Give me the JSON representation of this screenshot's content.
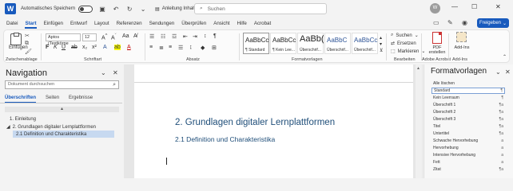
{
  "titlebar": {
    "autosave_label": "Automatisches Speichern",
    "document_title": "Anleitung Inhaltsverzeic...",
    "search_placeholder": "Suchen",
    "user_initials": "W"
  },
  "ribbon_tabs": [
    "Datei",
    "Start",
    "Einfügen",
    "Entwurf",
    "Layout",
    "Referenzen",
    "Sendungen",
    "Überprüfen",
    "Ansicht",
    "Hilfe",
    "Acrobat"
  ],
  "active_tab": "Start",
  "share_button": "Freigeben",
  "clipboard": {
    "paste_label": "Einfügen",
    "group_label": "Zwischenablage"
  },
  "font": {
    "family": "Aptos (Textkörpe",
    "size": "12",
    "group_label": "Schriftart"
  },
  "paragraph": {
    "group_label": "Absatz"
  },
  "styles": {
    "group_label": "Formatvorlagen",
    "cards": [
      {
        "sample": "AaBbCcI",
        "name": "¶ Standard"
      },
      {
        "sample": "AaBbCcI",
        "name": "¶ Kein Lee..."
      },
      {
        "sample": "AaBb(",
        "name": "Überschrif..."
      },
      {
        "sample": "AaBbC",
        "name": "Überschrif..."
      },
      {
        "sample": "AaBbCc",
        "name": "Überschrif..."
      }
    ]
  },
  "editing": {
    "group_label": "Bearbeiten",
    "search": "Suchen",
    "replace": "Ersetzen",
    "select": "Markieren"
  },
  "acrobat": {
    "pdf_label": "PDF erstellen",
    "group_label": "Adobe Acrobat"
  },
  "addins": {
    "label": "Add-Ins",
    "group_label": "Add-Ins"
  },
  "navigation": {
    "title": "Navigation",
    "search_placeholder": "Dokument durchsuchen",
    "tabs": [
      "Überschriften",
      "Seiten",
      "Ergebnisse"
    ],
    "items": [
      {
        "label": "1. Einleitung"
      },
      {
        "label": "2. Grundlagen digitaler Lernplattformen"
      },
      {
        "label": "2.1 Definition und Charakteristika"
      }
    ]
  },
  "document": {
    "heading1": "2. Grundlagen digitaler Lernplattformen",
    "heading2": "2.1 Definition und Charakteristika"
  },
  "format_pane": {
    "title": "Formatvorlagen",
    "items": [
      {
        "label": "Alle löschen",
        "symbol": ""
      },
      {
        "label": "Standard",
        "symbol": "¶"
      },
      {
        "label": "Kein Leerraum",
        "symbol": "¶"
      },
      {
        "label": "Überschrift 1",
        "symbol": "¶a"
      },
      {
        "label": "Überschrift 2",
        "symbol": "¶a"
      },
      {
        "label": "Überschrift 3",
        "symbol": "¶a"
      },
      {
        "label": "Titel",
        "symbol": "¶a"
      },
      {
        "label": "Untertitel",
        "symbol": "¶a"
      },
      {
        "label": "Schwache Hervorhebung",
        "symbol": "a"
      },
      {
        "label": "Hervorhebung",
        "symbol": "a"
      },
      {
        "label": "Intensive Hervorhebung",
        "symbol": "a"
      },
      {
        "label": "Fett",
        "symbol": "a"
      },
      {
        "label": "Zitat",
        "symbol": "¶a"
      }
    ]
  },
  "colors": {
    "accent": "#185abd",
    "heading": "#1f4e79",
    "selection": "#c7d9f0"
  }
}
